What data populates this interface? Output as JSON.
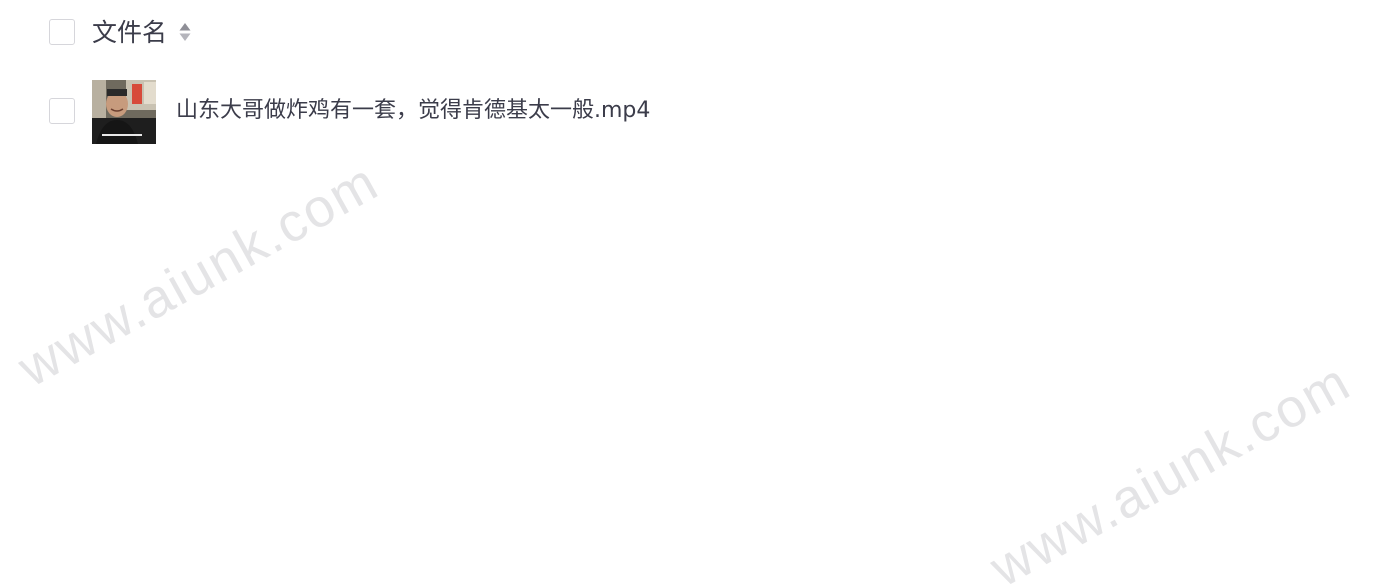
{
  "file_list": {
    "header": {
      "column_title": "文件名",
      "sort_icon": "sort-caret-up-down-icon"
    },
    "rows": [
      {
        "name": "山东大哥做炸鸡有一套，觉得肯德基太一般.mp4",
        "thumbnail_icon": "video-thumbnail"
      }
    ]
  },
  "watermark": {
    "text_1": "www.aiunk.com",
    "text_2": "www.aiunk.com"
  },
  "colors": {
    "text": "#3b3c4a",
    "checkbox_border": "#d6d6db",
    "sort_icon": "#9a9aa2",
    "watermark": "#c3c3c8"
  }
}
